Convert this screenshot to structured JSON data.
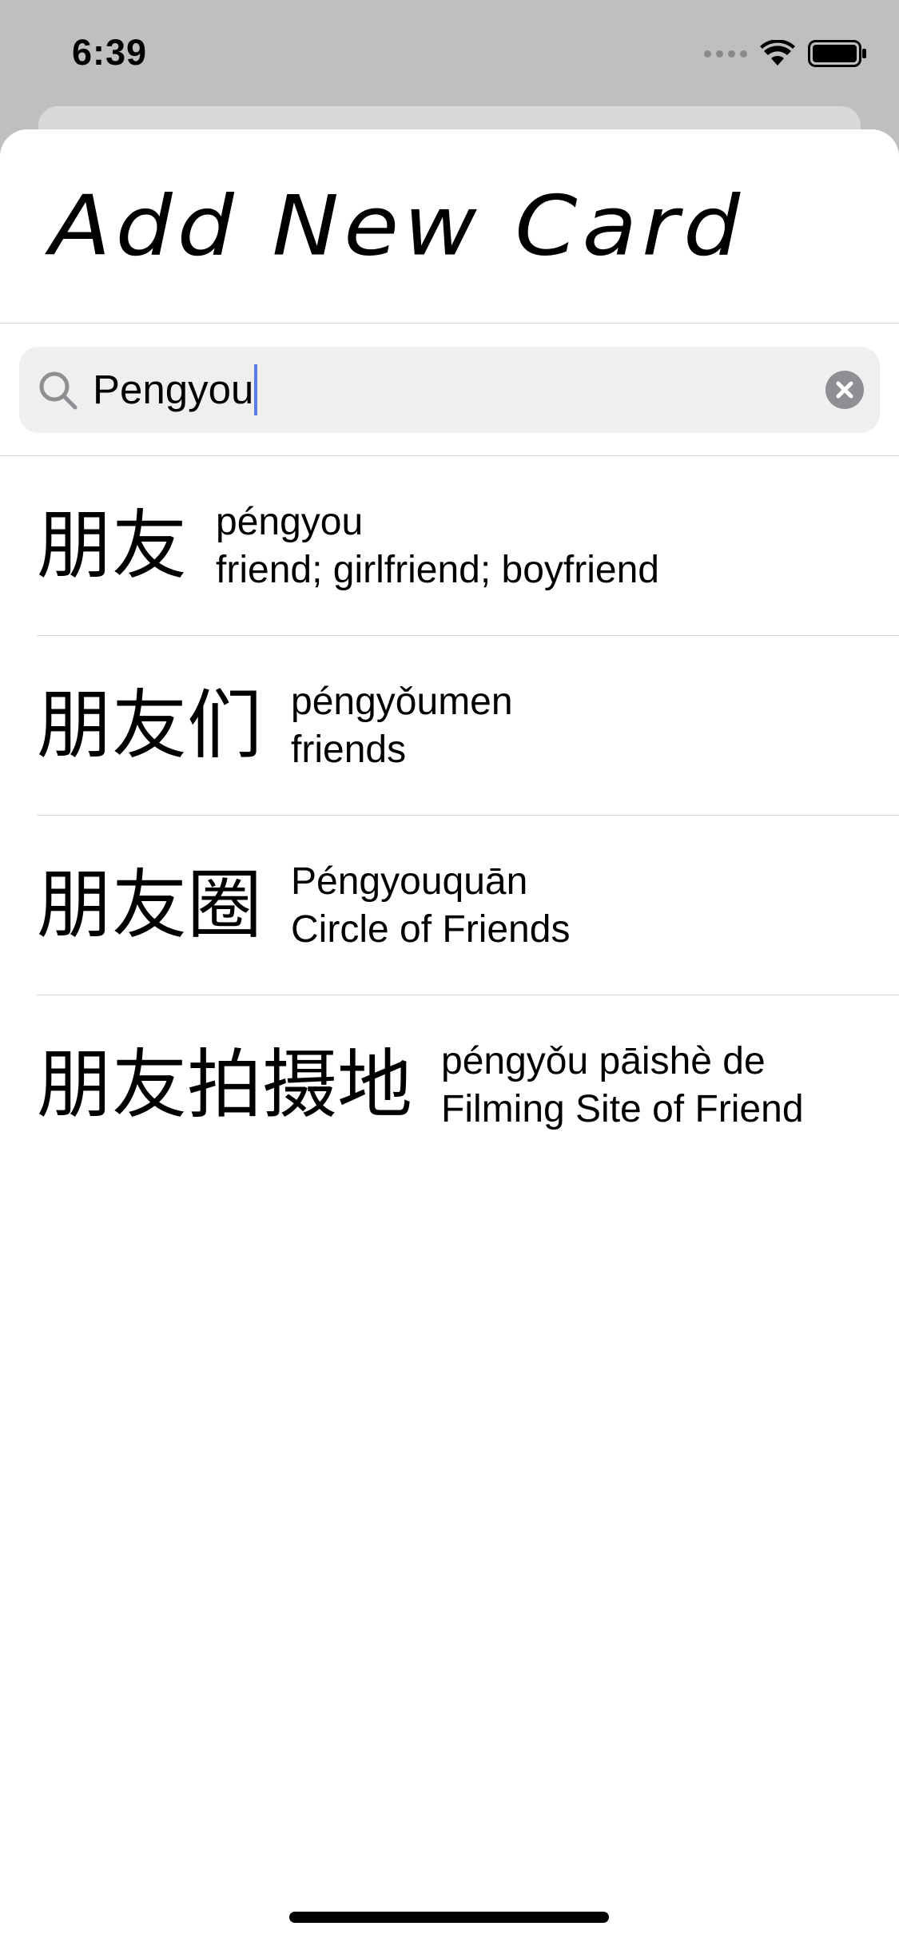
{
  "status_bar": {
    "time": "6:39"
  },
  "sheet": {
    "title": "Add New Card"
  },
  "search": {
    "value": "Pengyou"
  },
  "results": [
    {
      "hanzi": "朋友",
      "pinyin": "péngyou",
      "meaning": "friend; girlfriend; boyfriend"
    },
    {
      "hanzi": "朋友们",
      "pinyin": "péngyǒumen",
      "meaning": "friends"
    },
    {
      "hanzi": "朋友圈",
      "pinyin": "Péngyouquān",
      "meaning": "Circle of Friends"
    },
    {
      "hanzi": "朋友拍摄地",
      "pinyin": "péngyǒu pāishè de",
      "meaning": "Filming Site of Friend"
    }
  ],
  "colors": {
    "caret": "#5a7be0",
    "clear_button": "#8e8e93",
    "search_background": "#efefef",
    "backdrop": "#bfbfbf"
  },
  "icons": {
    "search": "magnifying-glass",
    "clear": "x-circle-fill",
    "wifi": "wifi",
    "battery": "battery-full"
  }
}
